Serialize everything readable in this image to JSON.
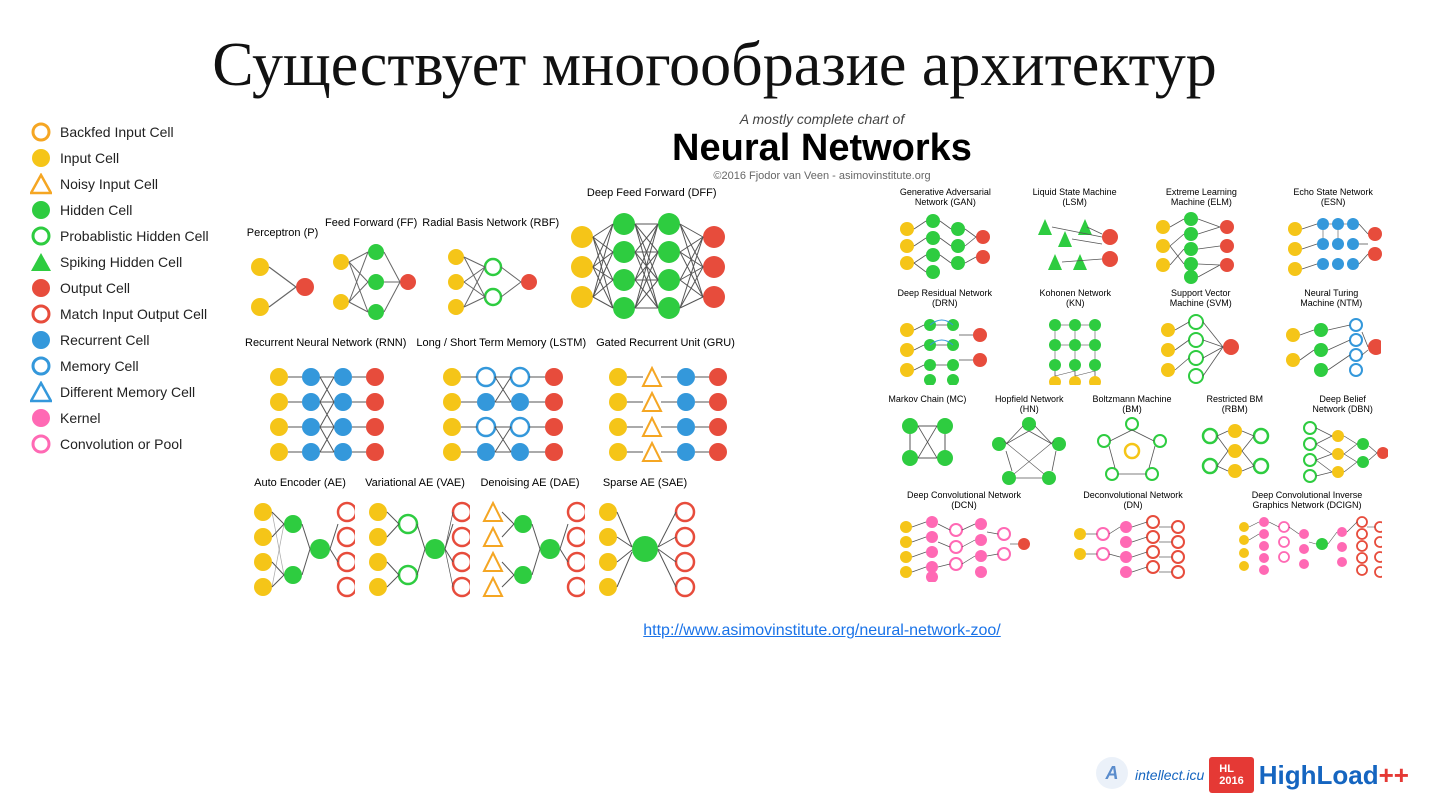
{
  "title": "Существует многообразие архитектур",
  "chart": {
    "subtitle": "A mostly complete chart of",
    "main_title": "Neural Networks",
    "credit": "©2016 Fjodor van Veen - asimovinstitute.org"
  },
  "legend": {
    "items": [
      {
        "id": "backfed-input",
        "label": "Backfed Input Cell",
        "type": "circle-outline",
        "color": "#f5a623",
        "border": "#f5a623"
      },
      {
        "id": "input",
        "label": "Input Cell",
        "type": "circle",
        "color": "#f5c518"
      },
      {
        "id": "noisy-input",
        "label": "Noisy Input Cell",
        "type": "triangle-outline",
        "color": "#f5a623"
      },
      {
        "id": "hidden",
        "label": "Hidden Cell",
        "type": "circle",
        "color": "#2ecc40"
      },
      {
        "id": "prob-hidden",
        "label": "Probablistic Hidden Cell",
        "type": "circle-outline",
        "color": "#2ecc40"
      },
      {
        "id": "spiking-hidden",
        "label": "Spiking Hidden Cell",
        "type": "triangle",
        "color": "#2ecc40"
      },
      {
        "id": "output",
        "label": "Output Cell",
        "type": "circle",
        "color": "#e74c3c"
      },
      {
        "id": "match-io",
        "label": "Match Input Output Cell",
        "type": "circle-outline",
        "color": "#e74c3c"
      },
      {
        "id": "recurrent",
        "label": "Recurrent Cell",
        "type": "circle",
        "color": "#3498db"
      },
      {
        "id": "memory",
        "label": "Memory Cell",
        "type": "circle",
        "color": "#3498db"
      },
      {
        "id": "diff-memory",
        "label": "Different Memory Cell",
        "type": "triangle",
        "color": "#3498db"
      },
      {
        "id": "kernel",
        "label": "Kernel",
        "type": "circle",
        "color": "#ff69b4"
      },
      {
        "id": "convolution",
        "label": "Convolution or Pool",
        "type": "circle-outline",
        "color": "#ff69b4"
      }
    ]
  },
  "networks": {
    "main_row1": [
      {
        "label": "Perceptron (P)"
      },
      {
        "label": "Feed Forward (FF)"
      },
      {
        "label": "Radial Basis Network (RBF)"
      },
      {
        "label": "Deep Feed Forward (DFF)"
      }
    ],
    "main_row2": [
      {
        "label": "Recurrent Neural Network (RNN)"
      },
      {
        "label": "Long / Short Term Memory (LSTM)"
      },
      {
        "label": "Gated Recurrent Unit (GRU)"
      }
    ],
    "main_row3": [
      {
        "label": "Auto Encoder (AE)"
      },
      {
        "label": "Variational AE (VAE)"
      },
      {
        "label": "Denoising AE (DAE)"
      },
      {
        "label": "Sparse AE (SAE)"
      }
    ],
    "right_row1": [
      {
        "label": "Generative Adversarial Network (GAN)"
      },
      {
        "label": "Liquid State Machine (LSM)"
      },
      {
        "label": "Extreme Learning Machine (ELM)"
      },
      {
        "label": "Echo State Network (ESN)"
      }
    ],
    "right_row2": [
      {
        "label": "Deep Residual Network (DRN)"
      },
      {
        "label": "Kohonen Network (KN)"
      },
      {
        "label": "Support Vector Machine (SVM)"
      },
      {
        "label": "Neural Turing Machine (NTM)"
      }
    ],
    "right_row3": [
      {
        "label": "Markov Chain (MC)"
      },
      {
        "label": "Hopfield Network (HN)"
      },
      {
        "label": "Boltzmann Machine (BM)"
      },
      {
        "label": "Restricted BM (RBM)"
      },
      {
        "label": "Deep Belief Network (DBN)"
      }
    ],
    "right_row4": [
      {
        "label": "Deep Convolutional Network (DCN)"
      },
      {
        "label": "Deconvolutional Network (DN)"
      },
      {
        "label": "Deep Convolutional Inverse Graphics Network (DCIGN)"
      }
    ]
  },
  "link": {
    "text": "http://www.asimovinstitute.org/neural-network-zoo/",
    "url": "http://www.asimovinstitute.org/neural-network-zoo/"
  },
  "badge": {
    "hl_year": "2016",
    "hl_label": "HighLoad",
    "plus": "++",
    "intellect": "intellect.icu"
  }
}
